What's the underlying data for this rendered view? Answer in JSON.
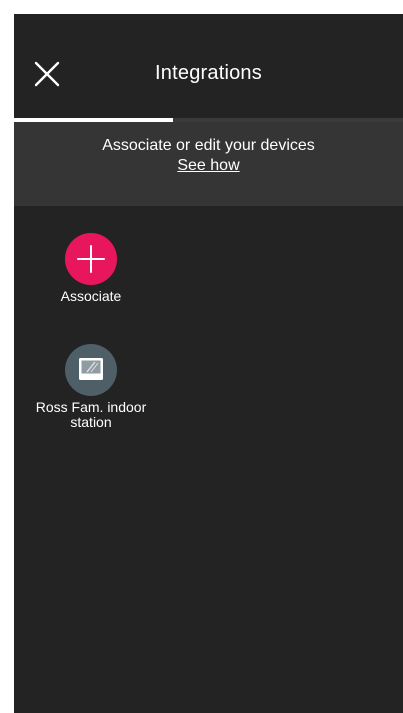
{
  "header": {
    "title": "Integrations",
    "close_icon": "close-icon"
  },
  "tabs": {
    "progress": 0.41
  },
  "banner": {
    "text": "Associate or edit your devices",
    "link": "See how"
  },
  "items": [
    {
      "label": "Associate",
      "icon": "plus-icon",
      "color": "#E8175D"
    },
    {
      "label": "Ross Fam. indoor station",
      "icon": "indoor-station-icon",
      "color": "#4E5F68"
    }
  ],
  "colors": {
    "background": "#232323",
    "banner": "#353535",
    "accent": "#E8175D",
    "device": "#4E5F68",
    "text": "#FFFFFF"
  }
}
